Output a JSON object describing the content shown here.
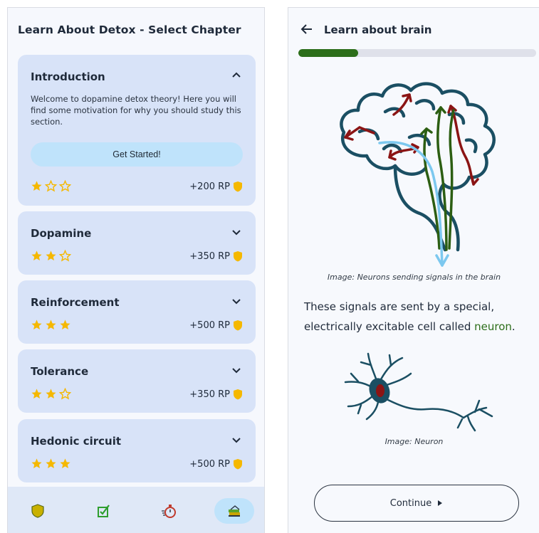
{
  "left": {
    "title": "Learn About Detox - Select Chapter",
    "chapters": [
      {
        "title": "Introduction",
        "expanded": true,
        "description": "Welcome to dopamine detox theory! Here you will find some motivation for why you should study this section.",
        "button": "Get Started!",
        "stars": 1,
        "reward": "+200 RP"
      },
      {
        "title": "Dopamine",
        "expanded": false,
        "stars": 2,
        "reward": "+350 RP"
      },
      {
        "title": "Reinforcement",
        "expanded": false,
        "stars": 3,
        "reward": "+500 RP"
      },
      {
        "title": "Tolerance",
        "expanded": false,
        "stars": 2,
        "reward": "+350 RP"
      },
      {
        "title": "Hedonic circuit",
        "expanded": false,
        "stars": 3,
        "reward": "+500 RP"
      }
    ],
    "bottom_nav": [
      {
        "icon": "shield-icon",
        "active": false
      },
      {
        "icon": "checkbox-icon",
        "active": false
      },
      {
        "icon": "stopwatch-icon",
        "active": false
      },
      {
        "icon": "learn-icon",
        "active": true
      }
    ]
  },
  "right": {
    "title": "Learn about brain",
    "progress": 0.25,
    "brain_caption": "Image: Neurons sending signals in the brain",
    "para_before": "These signals are sent by a special, electrically excitable cell called ",
    "para_highlight": "neuron",
    "para_after": ".",
    "neuron_caption": "Image: Neuron",
    "continue_label": "Continue"
  },
  "colors": {
    "accent": "#2c6e1a",
    "card": "#d8e3f8",
    "button": "#bfe3fb",
    "star": "#f5b800"
  }
}
